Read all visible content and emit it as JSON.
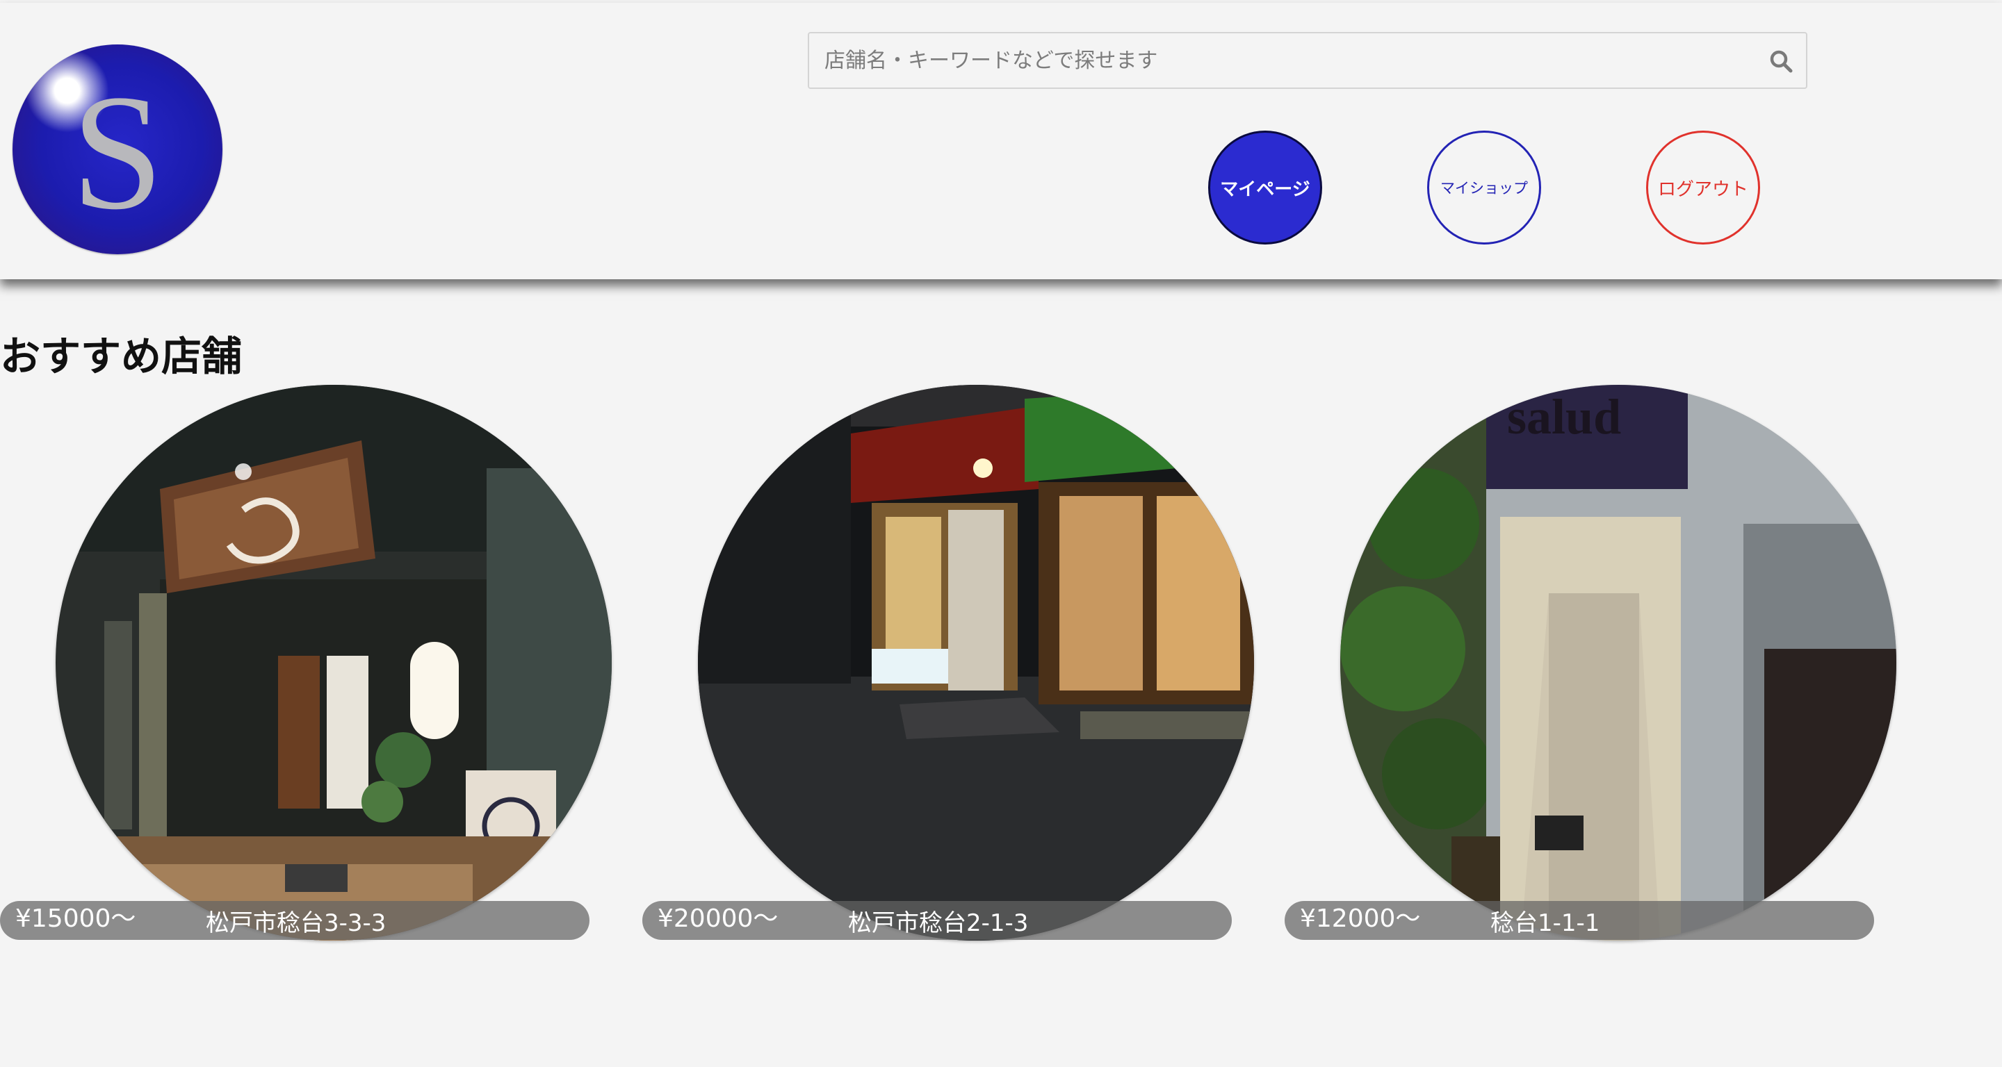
{
  "header": {
    "logo_letter": "S",
    "search": {
      "placeholder": "店舗名・キーワードなどで探せます",
      "value": ""
    },
    "nav": {
      "mypage_label": "マイページ",
      "myshop_label": "マイショップ",
      "logout_label": "ログアウト"
    }
  },
  "main": {
    "section_title": "おすすめ店舗",
    "shops": [
      {
        "price": "¥15000〜",
        "address": "松戸市稔台3-3-3"
      },
      {
        "price": "¥20000〜",
        "address": "松戸市稔台2-1-3"
      },
      {
        "price": "¥12000〜",
        "address": "稔台1-1-1"
      }
    ]
  },
  "colors": {
    "mypage_button": "#2b2bd0",
    "myshop_border": "#2323b4",
    "logout_border": "#e0322c",
    "background": "#f4f4f4"
  },
  "icons": {
    "search": "search-icon"
  }
}
